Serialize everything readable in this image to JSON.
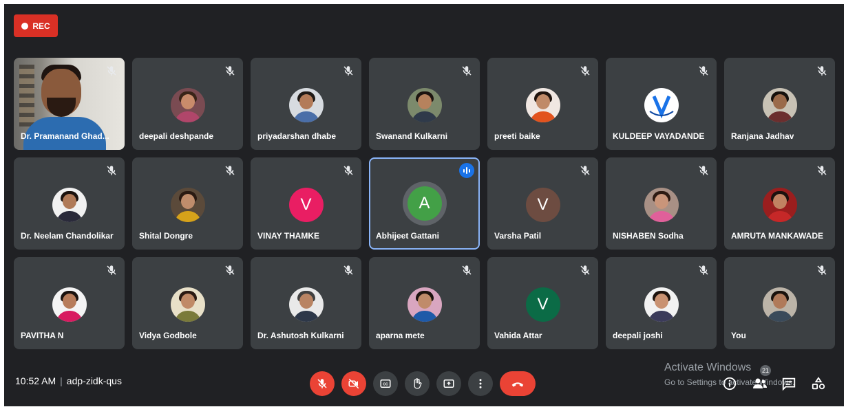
{
  "recording": {
    "label": "REC"
  },
  "participants": [
    {
      "name": "Dr. Pramanand Ghad...",
      "type": "video"
    },
    {
      "name": "deepali deshpande",
      "type": "photo",
      "skin": "#c98b6b",
      "hair": "#3a2418",
      "shirt": "#b0466a",
      "bg": "#7a4b52"
    },
    {
      "name": "priyadarshan dhabe",
      "type": "photo",
      "skin": "#b37b59",
      "hair": "#1f1a17",
      "shirt": "#4a6ea8",
      "bg": "#d7dbe0"
    },
    {
      "name": "Swanand Kulkarni",
      "type": "photo",
      "skin": "#b6825d",
      "hair": "#1c1410",
      "shirt": "#2f3a4a",
      "bg": "#7c8a6c"
    },
    {
      "name": "preeti baike",
      "type": "photo",
      "skin": "#c08a68",
      "hair": "#20140e",
      "shirt": "#e2531e",
      "bg": "#f0e7e2"
    },
    {
      "name": "KULDEEP VAYADANDE",
      "type": "logo",
      "bg": "#ffffff",
      "accent": "#1a73e8"
    },
    {
      "name": "Ranjana Jadhav",
      "type": "photo",
      "skin": "#9a6a4a",
      "hair": "#15100c",
      "shirt": "#6b2e2e",
      "bg": "#c8c2b5"
    },
    {
      "name": "Dr. Neelam Chandolikar",
      "type": "photo",
      "skin": "#b07a58",
      "hair": "#1b120e",
      "shirt": "#2a2a3a",
      "bg": "#f1f1f1"
    },
    {
      "name": "Shital Dongre",
      "type": "photo",
      "skin": "#c08d6c",
      "hair": "#2a1a12",
      "shirt": "#d6a21a",
      "bg": "#5b4a3a"
    },
    {
      "name": "VINAY THAMKE",
      "type": "letter",
      "letter": "V",
      "color": "#e91e63"
    },
    {
      "name": "Abhijeet Gattani",
      "type": "letter",
      "letter": "A",
      "color": "#43a047",
      "speaking": true
    },
    {
      "name": "Varsha Patil",
      "type": "letter",
      "letter": "V",
      "color": "#6d4c41"
    },
    {
      "name": "NISHABEN Sodha",
      "type": "photo",
      "skin": "#c9957a",
      "hair": "#2d1a12",
      "shirt": "#e0609a",
      "bg": "#a89085"
    },
    {
      "name": "AMRUTA MANKAWADE",
      "type": "photo",
      "skin": "#c18362",
      "hair": "#1b120e",
      "shirt": "#c62828",
      "bg": "#9a1e1e"
    },
    {
      "name": "PAVITHA N",
      "type": "photo",
      "skin": "#b77c5a",
      "hair": "#1a120e",
      "shirt": "#d81b60",
      "bg": "#f4f4f4"
    },
    {
      "name": "Vidya Godbole",
      "type": "photo",
      "skin": "#c08a67",
      "hair": "#2a1a12",
      "shirt": "#7a7a3a",
      "bg": "#e8e0c8"
    },
    {
      "name": "Dr. Ashutosh Kulkarni",
      "type": "photo",
      "skin": "#b98463",
      "hair": "#404040",
      "shirt": "#2d3748",
      "bg": "#e9e9e9"
    },
    {
      "name": "aparna mete",
      "type": "photo",
      "skin": "#c08b6a",
      "hair": "#1c120e",
      "shirt": "#1e5aa8",
      "bg": "#d9a6c0"
    },
    {
      "name": "Vahida Attar",
      "type": "letter",
      "letter": "V",
      "color": "#0b6b46"
    },
    {
      "name": "deepali joshi",
      "type": "photo",
      "skin": "#c99272",
      "hair": "#1d130e",
      "shirt": "#3b3b5a",
      "bg": "#f2f2f2"
    },
    {
      "name": "You",
      "type": "photo",
      "skin": "#b07a5a",
      "hair": "#1a120d",
      "shirt": "#3a4a5a",
      "bg": "#bcb4a8"
    }
  ],
  "footer": {
    "time": "10:52 AM",
    "meeting_code": "adp-zidk-qus",
    "controls": [
      {
        "name": "mic-off-button",
        "icon": "mic-off-icon"
      },
      {
        "name": "camera-off-button",
        "icon": "camera-off-icon"
      },
      {
        "name": "captions-button",
        "icon": "captions-icon"
      },
      {
        "name": "raise-hand-button",
        "icon": "hand-icon"
      },
      {
        "name": "present-button",
        "icon": "present-icon"
      },
      {
        "name": "more-options-button",
        "icon": "more-vert-icon"
      },
      {
        "name": "leave-call-button",
        "icon": "call-end-icon"
      }
    ],
    "participants_count": "21"
  },
  "watermark": {
    "line1": "Activate Windows",
    "line2": "Go to Settings to activate Windows."
  }
}
